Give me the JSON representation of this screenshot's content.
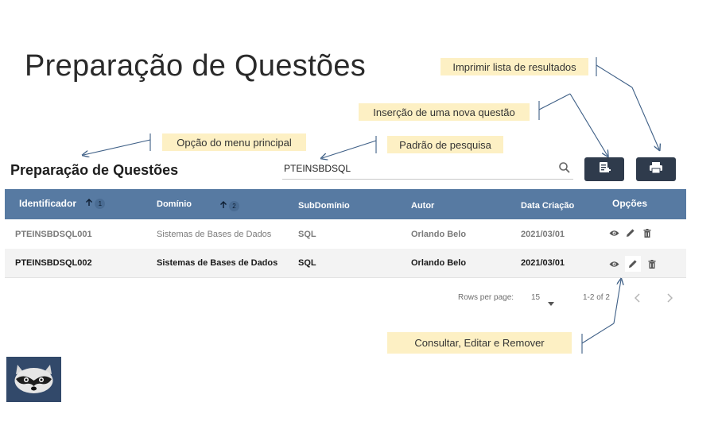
{
  "slide": {
    "title": "Preparação de Questões"
  },
  "callouts": {
    "print": "Imprimir lista de resultados",
    "insert": "Inserção de uma nova questão",
    "menu_option": "Opção do menu principal",
    "search_pattern": "Padrão de pesquisa",
    "actions": "Consultar, Editar e Remover"
  },
  "app": {
    "heading": "Preparação de Questões",
    "search": {
      "value": "PTEINSBDSQL"
    },
    "buttons": {
      "add_icon": "add-document-icon",
      "print_icon": "print-icon"
    },
    "table": {
      "headers": {
        "identificador": "Identificador",
        "dominio": "Domínio",
        "subdominio": "SubDomínio",
        "autor": "Autor",
        "data_criacao": "Data Criação",
        "opcoes": "Opções"
      },
      "sort": {
        "identificador_order": "1",
        "dominio_order": "2"
      },
      "rows": [
        {
          "id": "PTEINSBDSQL001",
          "dominio": "Sistemas de Bases de Dados",
          "subdominio": "SQL",
          "autor": "Orlando Belo",
          "data": "2021/03/01"
        },
        {
          "id": "PTEINSBDSQL002",
          "dominio": "Sistemas de Bases de Dados",
          "subdominio": "SQL",
          "autor": "Orlando Belo",
          "data": "2021/03/01"
        }
      ],
      "row_icons": [
        "eye-icon",
        "pencil-icon",
        "trash-icon"
      ]
    },
    "pagination": {
      "rows_per_page_label": "Rows per page:",
      "rows_per_page_value": "15",
      "range": "1-2 of 2"
    }
  },
  "colors": {
    "header_bg": "#577aa2",
    "button_bg": "#2f3b4c",
    "callout_bg": "#fdf0c4",
    "arrow": "#3e5f86"
  }
}
